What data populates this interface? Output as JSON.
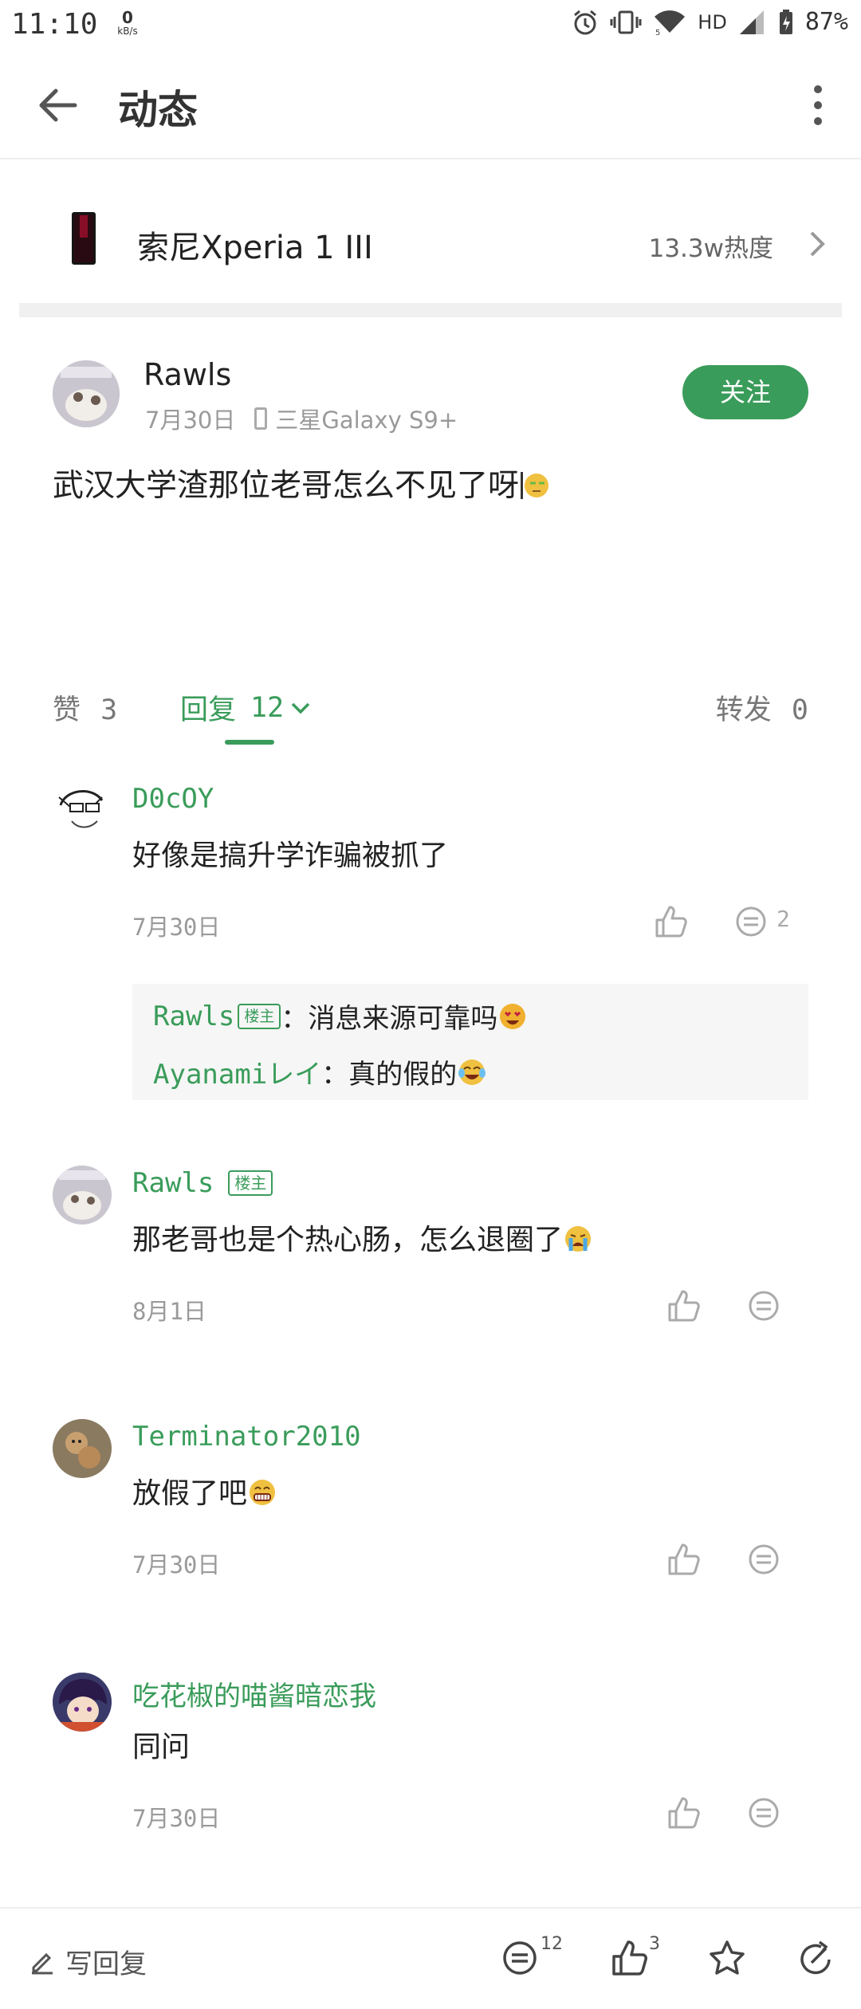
{
  "status_bar": {
    "time": "11:10",
    "net_speed_value": "0",
    "net_speed_unit": "kB/s",
    "network_label": "HD",
    "battery": "87%"
  },
  "app_bar": {
    "title": "动态"
  },
  "device": {
    "name": "索尼Xperia 1 III",
    "heat": "13.3w热度"
  },
  "post": {
    "author": "Rawls",
    "date": "7月30日",
    "device": "三星Galaxy S9+",
    "follow_label": "关注",
    "text": "武汉大学渣那位老哥怎么不见了呀"
  },
  "tabs": {
    "like_label": "赞",
    "like_count": "3",
    "reply_label": "回复",
    "reply_count": "12",
    "forward_label": "转发",
    "forward_count": "0"
  },
  "comments": [
    {
      "name": "D0cOY",
      "text": "好像是搞升学诈骗被抓了",
      "date": "7月30日",
      "reply_count": "2",
      "sub_replies": [
        {
          "who": "Rawls",
          "badge": "楼主",
          "text": "：消息来源可靠吗"
        },
        {
          "who": "Ayanamiレイ",
          "text": "：真的假的"
        }
      ]
    },
    {
      "name": "Rawls",
      "badge": "楼主",
      "text": "那老哥也是个热心肠，怎么退圈了",
      "date": "8月1日"
    },
    {
      "name": "Terminator2010",
      "text": "放假了吧",
      "date": "7月30日"
    },
    {
      "name": "吃花椒的喵酱暗恋我",
      "text": "同问",
      "date": "7月30日"
    }
  ],
  "bottom_bar": {
    "write_label": "写回复",
    "comment_count": "12",
    "like_count": "3"
  },
  "colors": {
    "accent": "#3a9c5a",
    "text": "#222222",
    "muted": "#9a9a9a"
  }
}
